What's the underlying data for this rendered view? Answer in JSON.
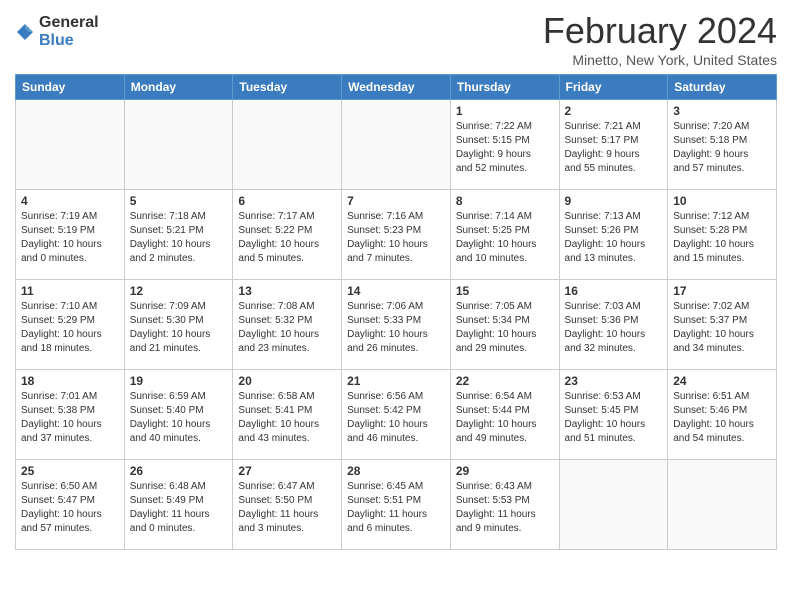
{
  "logo": {
    "general": "General",
    "blue": "Blue"
  },
  "header": {
    "month": "February 2024",
    "location": "Minetto, New York, United States"
  },
  "weekdays": [
    "Sunday",
    "Monday",
    "Tuesday",
    "Wednesday",
    "Thursday",
    "Friday",
    "Saturday"
  ],
  "weeks": [
    [
      {
        "day": "",
        "info": ""
      },
      {
        "day": "",
        "info": ""
      },
      {
        "day": "",
        "info": ""
      },
      {
        "day": "",
        "info": ""
      },
      {
        "day": "1",
        "info": "Sunrise: 7:22 AM\nSunset: 5:15 PM\nDaylight: 9 hours\nand 52 minutes."
      },
      {
        "day": "2",
        "info": "Sunrise: 7:21 AM\nSunset: 5:17 PM\nDaylight: 9 hours\nand 55 minutes."
      },
      {
        "day": "3",
        "info": "Sunrise: 7:20 AM\nSunset: 5:18 PM\nDaylight: 9 hours\nand 57 minutes."
      }
    ],
    [
      {
        "day": "4",
        "info": "Sunrise: 7:19 AM\nSunset: 5:19 PM\nDaylight: 10 hours\nand 0 minutes."
      },
      {
        "day": "5",
        "info": "Sunrise: 7:18 AM\nSunset: 5:21 PM\nDaylight: 10 hours\nand 2 minutes."
      },
      {
        "day": "6",
        "info": "Sunrise: 7:17 AM\nSunset: 5:22 PM\nDaylight: 10 hours\nand 5 minutes."
      },
      {
        "day": "7",
        "info": "Sunrise: 7:16 AM\nSunset: 5:23 PM\nDaylight: 10 hours\nand 7 minutes."
      },
      {
        "day": "8",
        "info": "Sunrise: 7:14 AM\nSunset: 5:25 PM\nDaylight: 10 hours\nand 10 minutes."
      },
      {
        "day": "9",
        "info": "Sunrise: 7:13 AM\nSunset: 5:26 PM\nDaylight: 10 hours\nand 13 minutes."
      },
      {
        "day": "10",
        "info": "Sunrise: 7:12 AM\nSunset: 5:28 PM\nDaylight: 10 hours\nand 15 minutes."
      }
    ],
    [
      {
        "day": "11",
        "info": "Sunrise: 7:10 AM\nSunset: 5:29 PM\nDaylight: 10 hours\nand 18 minutes."
      },
      {
        "day": "12",
        "info": "Sunrise: 7:09 AM\nSunset: 5:30 PM\nDaylight: 10 hours\nand 21 minutes."
      },
      {
        "day": "13",
        "info": "Sunrise: 7:08 AM\nSunset: 5:32 PM\nDaylight: 10 hours\nand 23 minutes."
      },
      {
        "day": "14",
        "info": "Sunrise: 7:06 AM\nSunset: 5:33 PM\nDaylight: 10 hours\nand 26 minutes."
      },
      {
        "day": "15",
        "info": "Sunrise: 7:05 AM\nSunset: 5:34 PM\nDaylight: 10 hours\nand 29 minutes."
      },
      {
        "day": "16",
        "info": "Sunrise: 7:03 AM\nSunset: 5:36 PM\nDaylight: 10 hours\nand 32 minutes."
      },
      {
        "day": "17",
        "info": "Sunrise: 7:02 AM\nSunset: 5:37 PM\nDaylight: 10 hours\nand 34 minutes."
      }
    ],
    [
      {
        "day": "18",
        "info": "Sunrise: 7:01 AM\nSunset: 5:38 PM\nDaylight: 10 hours\nand 37 minutes."
      },
      {
        "day": "19",
        "info": "Sunrise: 6:59 AM\nSunset: 5:40 PM\nDaylight: 10 hours\nand 40 minutes."
      },
      {
        "day": "20",
        "info": "Sunrise: 6:58 AM\nSunset: 5:41 PM\nDaylight: 10 hours\nand 43 minutes."
      },
      {
        "day": "21",
        "info": "Sunrise: 6:56 AM\nSunset: 5:42 PM\nDaylight: 10 hours\nand 46 minutes."
      },
      {
        "day": "22",
        "info": "Sunrise: 6:54 AM\nSunset: 5:44 PM\nDaylight: 10 hours\nand 49 minutes."
      },
      {
        "day": "23",
        "info": "Sunrise: 6:53 AM\nSunset: 5:45 PM\nDaylight: 10 hours\nand 51 minutes."
      },
      {
        "day": "24",
        "info": "Sunrise: 6:51 AM\nSunset: 5:46 PM\nDaylight: 10 hours\nand 54 minutes."
      }
    ],
    [
      {
        "day": "25",
        "info": "Sunrise: 6:50 AM\nSunset: 5:47 PM\nDaylight: 10 hours\nand 57 minutes."
      },
      {
        "day": "26",
        "info": "Sunrise: 6:48 AM\nSunset: 5:49 PM\nDaylight: 11 hours\nand 0 minutes."
      },
      {
        "day": "27",
        "info": "Sunrise: 6:47 AM\nSunset: 5:50 PM\nDaylight: 11 hours\nand 3 minutes."
      },
      {
        "day": "28",
        "info": "Sunrise: 6:45 AM\nSunset: 5:51 PM\nDaylight: 11 hours\nand 6 minutes."
      },
      {
        "day": "29",
        "info": "Sunrise: 6:43 AM\nSunset: 5:53 PM\nDaylight: 11 hours\nand 9 minutes."
      },
      {
        "day": "",
        "info": ""
      },
      {
        "day": "",
        "info": ""
      }
    ]
  ]
}
